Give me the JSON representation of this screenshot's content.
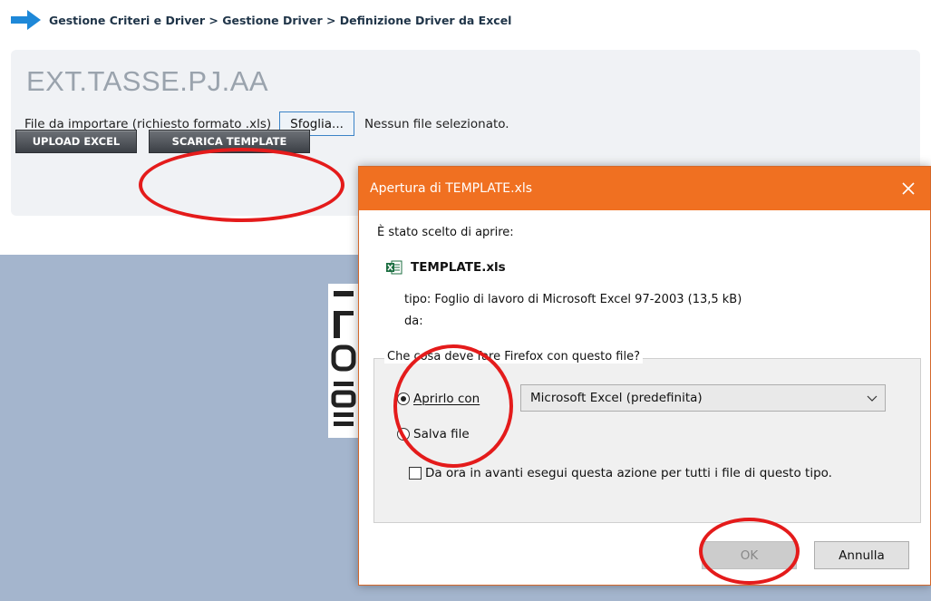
{
  "breadcrumb": {
    "text": "Gestione Criteri e Driver > Gestione Driver > Definizione Driver da Excel"
  },
  "page": {
    "title": "EXT.TASSE.PJ.AA",
    "file_label": "File da importare (richiesto formato .xls)",
    "browse_label": "Sfoglia...",
    "no_file": "Nessun file selezionato.",
    "upload_label": "UPLOAD EXCEL",
    "template_label": "SCARICA TEMPLATE"
  },
  "dialog": {
    "title": "Apertura di TEMPLATE.xls",
    "chosen_label": "È stato scelto di aprire:",
    "filename": "TEMPLATE.xls",
    "type_line": "tipo:  Foglio di lavoro di Microsoft Excel 97-2003 (13,5 kB)",
    "from_line": "da:",
    "question": "Che cosa deve fare Firefox con questo file?",
    "open_with_label": "Aprirlo con",
    "open_with_value": "Microsoft Excel (predefinita)",
    "save_label": "Salva file",
    "always_label": "Da ora in avanti esegui questa azione per tutti i file di questo tipo.",
    "ok_label": "OK",
    "cancel_label": "Annulla",
    "open_selected": true,
    "always_checked": false
  },
  "colors": {
    "dialog_title_bg": "#f07021",
    "highlight_ellipse": "#e41b1b",
    "background_area": "#a4b5cd",
    "breadcrumb_arrow": "#1e88d8"
  },
  "icons": {
    "breadcrumb": "arrow-right-icon",
    "file": "excel-file-icon",
    "close": "close-icon",
    "dropdown": "chevron-down-icon"
  }
}
